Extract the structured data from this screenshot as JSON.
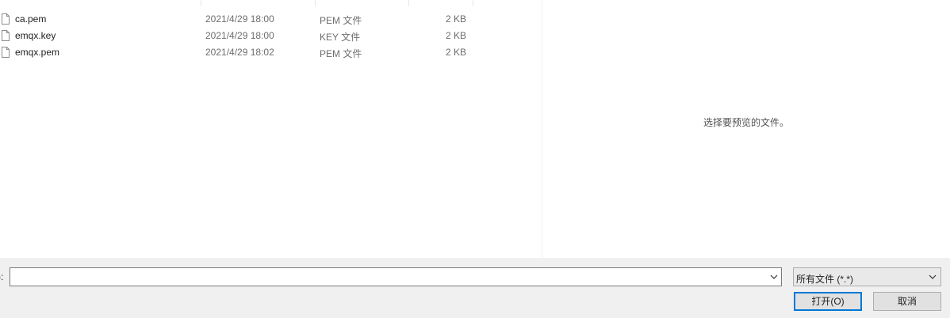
{
  "files": [
    {
      "name": "ca.pem",
      "date": "2021/4/29 18:00",
      "type": "PEM 文件",
      "size": "2 KB"
    },
    {
      "name": "emqx.key",
      "date": "2021/4/29 18:00",
      "type": "KEY 文件",
      "size": "2 KB"
    },
    {
      "name": "emqx.pem",
      "date": "2021/4/29 18:02",
      "type": "PEM 文件",
      "size": "2 KB"
    }
  ],
  "preview": {
    "message": "选择要预览的文件。"
  },
  "footer": {
    "filename_label": "):",
    "filename_value": "",
    "file_type_selected": "所有文件 (*.*)",
    "open_button": "打开(O)",
    "cancel_button": "取消"
  },
  "icons": {
    "file": "file-icon",
    "dropdown": "chevron-down-icon"
  }
}
